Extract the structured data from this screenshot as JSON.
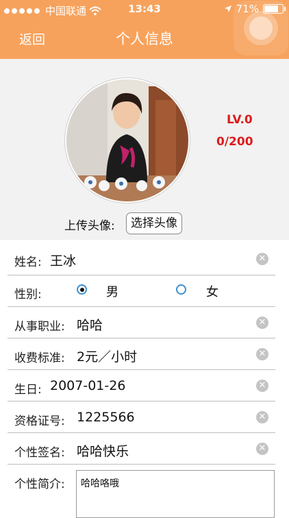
{
  "status_bar": {
    "carrier": "中国联通",
    "time": "13:43",
    "battery": "71%"
  },
  "nav": {
    "back": "返回",
    "title": "个人信息"
  },
  "profile": {
    "level": "LV.0",
    "points": "0/200",
    "upload_label": "上传头像:",
    "upload_button": "选择头像"
  },
  "form": {
    "name": {
      "label": "姓名:",
      "value": "王冰"
    },
    "gender": {
      "label": "性别:",
      "male": "男",
      "female": "女",
      "selected": "男"
    },
    "occupation": {
      "label": "从事职业:",
      "value": "哈哈"
    },
    "fee": {
      "label": "收费标准:",
      "value": "2元／小时"
    },
    "birthday": {
      "label": "生日:",
      "value": "2007-01-26"
    },
    "cert": {
      "label": "资格证号:",
      "value": "1225566"
    },
    "signature": {
      "label": "个性签名:",
      "value": "哈哈快乐"
    },
    "intro": {
      "label": "个性简介:",
      "value": "哈哈咯哦"
    }
  },
  "colors": {
    "accent": "#f7a25c",
    "level_red": "#dd1c1c",
    "radio_blue": "#3a8fd0"
  }
}
